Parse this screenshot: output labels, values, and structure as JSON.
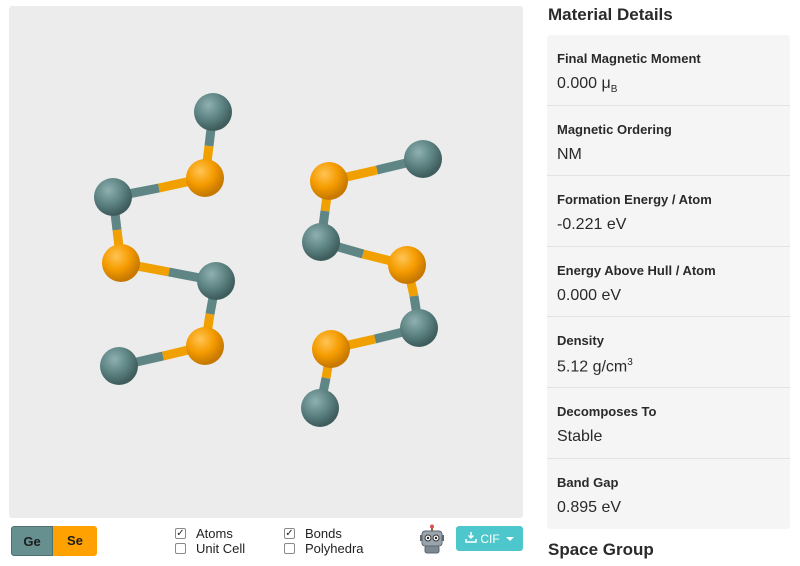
{
  "viewer": {
    "legend": [
      {
        "symbol": "Ge",
        "color": "#668f8f"
      },
      {
        "symbol": "Se",
        "color": "#ffa100"
      }
    ],
    "toggles": [
      {
        "label": "Atoms",
        "checked": true
      },
      {
        "label": "Unit Cell",
        "checked": false
      },
      {
        "label": "Bonds",
        "checked": true
      },
      {
        "label": "Polyhedra",
        "checked": false
      }
    ],
    "export": {
      "label": "CIF"
    },
    "ai_icon": "robot-icon"
  },
  "sidebar": {
    "title": "Material Details",
    "properties": [
      {
        "label": "Final Magnetic Moment",
        "value": "0.000 μ",
        "sub": "B"
      },
      {
        "label": "Magnetic Ordering",
        "value": "NM"
      },
      {
        "label": "Formation Energy / Atom",
        "value": "-0.221 eV"
      },
      {
        "label": "Energy Above Hull / Atom",
        "value": "0.000 eV"
      },
      {
        "label": "Density",
        "value": "5.12 g/cm",
        "sup": "3"
      },
      {
        "label": "Decomposes To",
        "value": "Stable"
      },
      {
        "label": "Band Gap",
        "value": "0.895 eV"
      }
    ],
    "next_section": "Space Group"
  }
}
